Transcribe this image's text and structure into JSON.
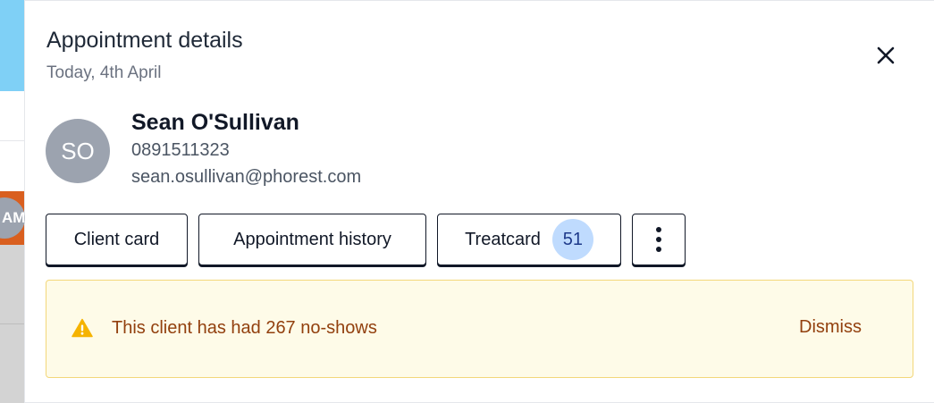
{
  "background": {
    "avatar_initials": "AM"
  },
  "drawer": {
    "title": "Appointment details",
    "subtitle": "Today, 4th April",
    "close_icon": "close-icon"
  },
  "client": {
    "initials": "SO",
    "name": "Sean O'Sullivan",
    "phone": "0891511323",
    "email": "sean.osullivan@phorest.com"
  },
  "actions": {
    "client_card_label": "Client card",
    "appointment_history_label": "Appointment history",
    "treatcard_label": "Treatcard",
    "treatcard_count": "51",
    "more_icon": "more-vertical-icon"
  },
  "alert": {
    "icon": "warning-icon",
    "message": "This client has had 267 no-shows",
    "dismiss_label": "Dismiss"
  },
  "colors": {
    "alert_background": "#fefbe8",
    "alert_border": "#f3d77a",
    "alert_text": "#92400e",
    "warning_icon": "#f5b301",
    "badge_background": "#bfdbfe",
    "avatar_background": "#9ca3af",
    "calendar_blue": "#7fd0f6",
    "calendar_orange": "#d95f1f"
  }
}
